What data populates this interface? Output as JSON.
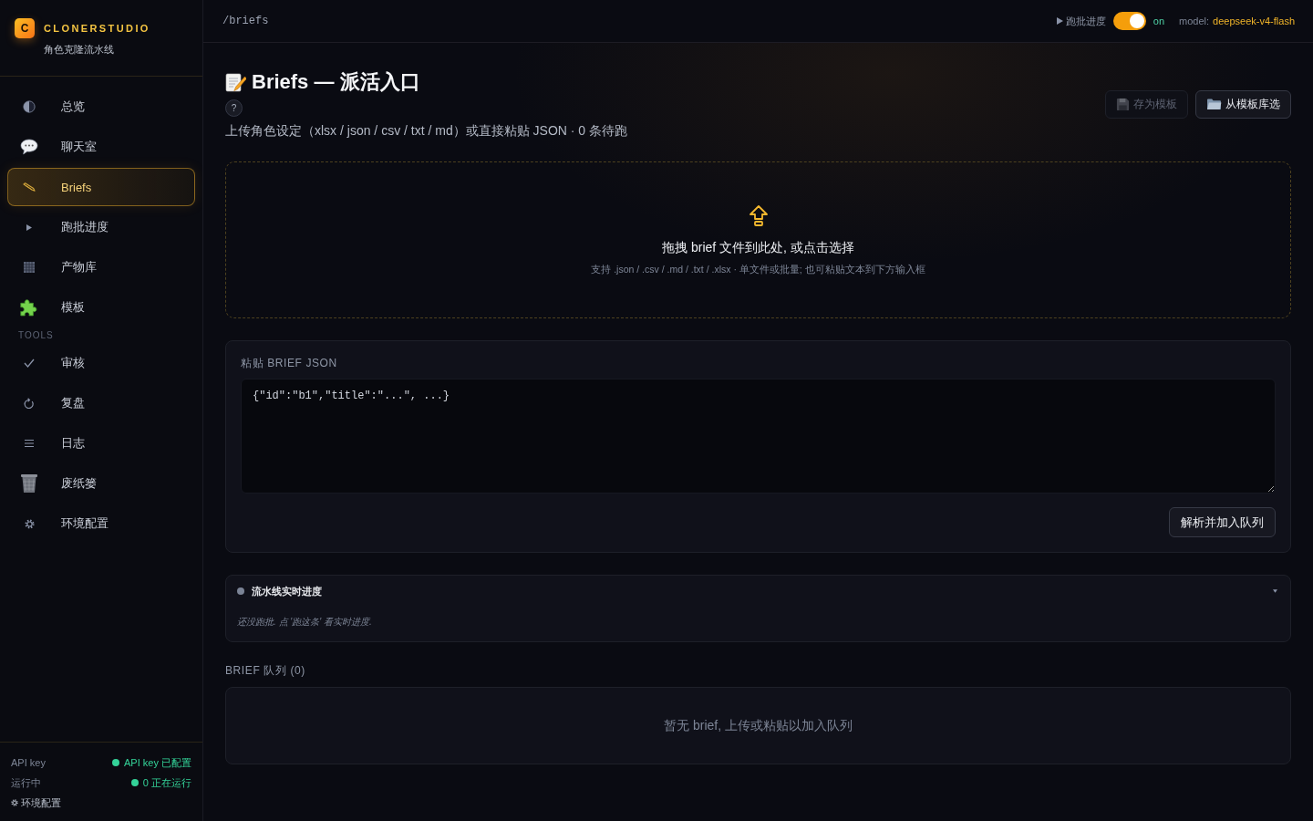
{
  "sidebar": {
    "brand": {
      "logo": "C",
      "name": "CLONERSTUDIO",
      "subtitle": "角色克隆流水线"
    },
    "nav": [
      {
        "label": "总览",
        "selected": false
      },
      {
        "label": "聊天室",
        "selected": false
      },
      {
        "label": "Briefs",
        "selected": true
      },
      {
        "label": "跑批进度",
        "selected": false
      },
      {
        "label": "产物库",
        "selected": false
      },
      {
        "label": "模板",
        "selected": false
      }
    ],
    "tools": {
      "title": "TOOLS",
      "items": [
        {
          "label": "审核",
          "selected": false
        },
        {
          "label": "复盘",
          "selected": false
        },
        {
          "label": "日志",
          "selected": false
        },
        {
          "label": "废纸篓",
          "selected": false
        },
        {
          "label": "环境配置",
          "selected": false
        }
      ]
    },
    "footer": {
      "status": [
        {
          "label": "API key",
          "value": "API key 已配置",
          "ok": true
        },
        {
          "label": "运行中",
          "value": "0 正在运行",
          "ok": true
        }
      ],
      "settings_link": "环境配置"
    }
  },
  "top_bar": {
    "path": "/briefs",
    "batch_toggle": {
      "label": "跑批进度",
      "on": true,
      "state": "on"
    },
    "model_label": "model:",
    "model": "deepseek-v4-flash"
  },
  "page": {
    "title": "Briefs — 派活入口",
    "help": "?",
    "subtitle": "上传角色设定（xlsx / json / csv / txt / md）或直接粘贴 JSON · 0 条待跑",
    "buttons": [
      {
        "label": "存为模板",
        "disabled": true
      },
      {
        "label": "从模板库选",
        "disabled": false
      }
    ]
  },
  "drop_zone": {
    "title": "拖拽 brief 文件到此处, 或点击选择",
    "hint": "支持 .json / .csv / .md / .txt / .xlsx · 单文件或批量; 也可粘贴文本到下方输入框"
  },
  "paste_panel": {
    "label": "粘贴 BRIEF JSON",
    "placeholder": "{\"id\":\"b1\",\"title\":\"...\", ...}",
    "button": "解析并加入队列"
  },
  "pipeline_panel": {
    "title": "流水线实时进度",
    "expanded": true,
    "message": "还没跑批. 点 '跑这条' 看实时进度."
  },
  "queue": {
    "title": "BRIEF 队列 (0)",
    "empty_message": "暂无 brief, 上传或粘贴以加入队列"
  }
}
